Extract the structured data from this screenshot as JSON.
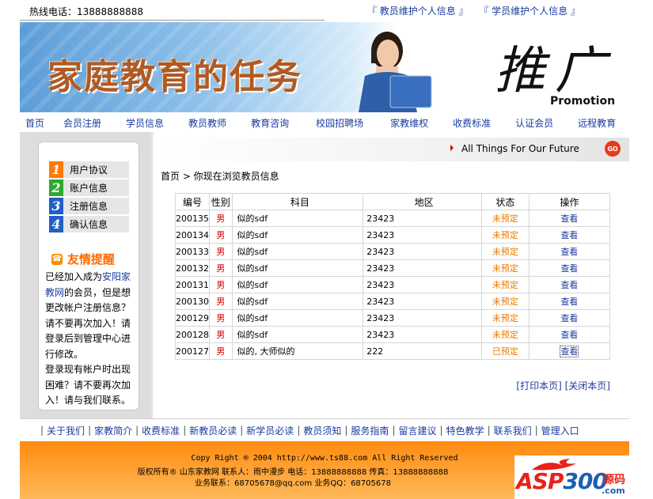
{
  "topbar": {
    "hotline": "热线电话：13888888888",
    "links": [
      "『 教员维护个人信息 』",
      "『 学员维护个人信息 』"
    ]
  },
  "banner": {
    "title": "家庭教育的任务",
    "tui": "推广",
    "promotion": "Promotion"
  },
  "nav": [
    "首页",
    "会员注册",
    "学员信息",
    "教员教师",
    "教育咨询",
    "校园招聘场",
    "家教维权",
    "收费标准",
    "认证会员",
    "远程教育"
  ],
  "sidebar": {
    "items": [
      {
        "num": "1",
        "label": "用户协议",
        "color": "#ff7a00"
      },
      {
        "num": "2",
        "label": "账户信息",
        "color": "#2fa82f"
      },
      {
        "num": "3",
        "label": "注册信息",
        "color": "#1f5fc7"
      },
      {
        "num": "4",
        "label": "确认信息",
        "color": "#1f5fc7"
      }
    ],
    "remind_title": "友情提醒",
    "notice_a": "已经加入成为",
    "notice_site": "安阳家教网",
    "notice_b": "的会员，但是想更改帐户注册信息？请不要再次加入！请登录后到管理中心进行修改。",
    "notice_c": "登录现有帐户时出现困难？请不要再次加入！请与我们联系。"
  },
  "main": {
    "slogan": "All Things For Our Future",
    "go_label": "GO",
    "breadcrumb": "首页 > 你现在浏览教员信息",
    "columns": [
      "编号",
      "性别",
      "科目",
      "地区",
      "状态",
      "操作"
    ],
    "rows": [
      {
        "id": "200135",
        "sex": "男",
        "subject": "似的sdf",
        "area": "23423",
        "status": "未预定",
        "op": "查看"
      },
      {
        "id": "200134",
        "sex": "男",
        "subject": "似的sdf",
        "area": "23423",
        "status": "未预定",
        "op": "查看"
      },
      {
        "id": "200133",
        "sex": "男",
        "subject": "似的sdf",
        "area": "23423",
        "status": "未预定",
        "op": "查看"
      },
      {
        "id": "200132",
        "sex": "男",
        "subject": "似的sdf",
        "area": "23423",
        "status": "未预定",
        "op": "查看"
      },
      {
        "id": "200131",
        "sex": "男",
        "subject": "似的sdf",
        "area": "23423",
        "status": "未预定",
        "op": "查看"
      },
      {
        "id": "200130",
        "sex": "男",
        "subject": "似的sdf",
        "area": "23423",
        "status": "未预定",
        "op": "查看"
      },
      {
        "id": "200129",
        "sex": "男",
        "subject": "似的sdf",
        "area": "23423",
        "status": "未预定",
        "op": "查看"
      },
      {
        "id": "200128",
        "sex": "男",
        "subject": "似的sdf",
        "area": "23423",
        "status": "未预定",
        "op": "查看"
      },
      {
        "id": "200127",
        "sex": "男",
        "subject": "似的, 大师似的",
        "area": "222",
        "status": "已预定",
        "op": "查看"
      }
    ],
    "print_label": "[打印本页]",
    "close_label": "[关闭本页]"
  },
  "footer_nav": [
    "关于我们",
    "家教简介",
    "收费标准",
    "新教员必读",
    "新学员必读",
    "教员须知",
    "服务指南",
    "留言建议",
    "特色教学",
    "联系我们",
    "管理入口"
  ],
  "footer": {
    "copyright": "Copy Right ® 2004 http://www.ts88.com All Right Reserved",
    "owner": "版权所有® 山东家教网 联系人：雨中漫步 电话：13888888888 传真：13888888888",
    "business": "业务联系：68705678@qq.com  业务QQ：68705678"
  },
  "logo": {
    "asp": "ASP",
    "num": "300",
    "ym": "源码",
    "com": ".com"
  }
}
